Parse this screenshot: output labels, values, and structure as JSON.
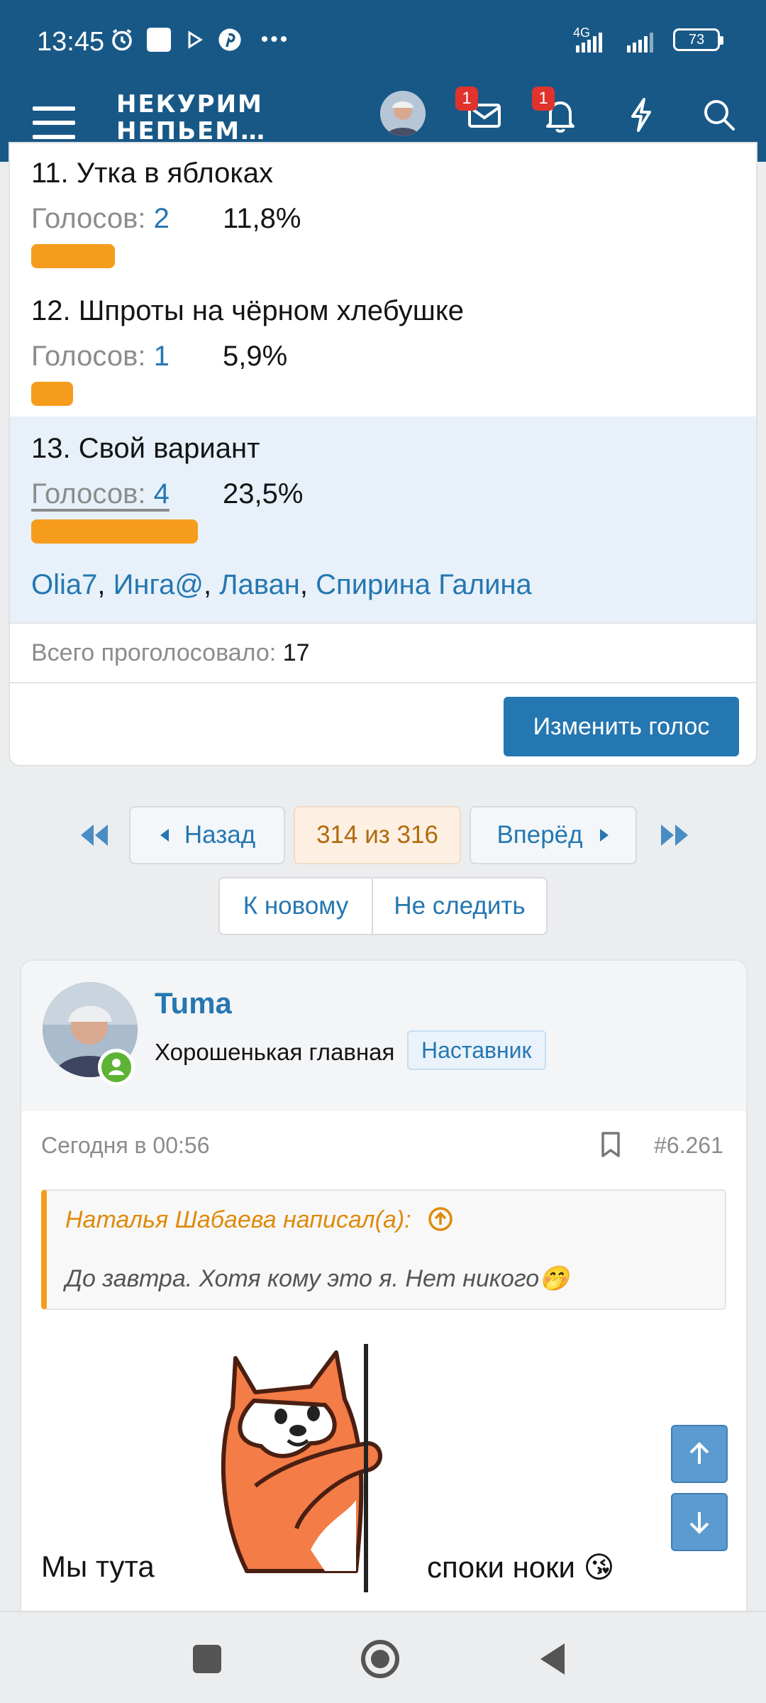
{
  "status_bar": {
    "time": "13:45",
    "network": "4G",
    "battery": "73",
    "icons": [
      "alarm-icon",
      "notification-square-icon",
      "play-icon",
      "pinterest-icon",
      "more-dots-icon",
      "signal-icon",
      "battery-icon"
    ]
  },
  "header": {
    "logo_line1": "НЕКУРИМ",
    "logo_line2": "НЕПЬЕМ…",
    "messages_badge": "1",
    "alerts_badge": "1",
    "accent_color": "#185886"
  },
  "poll": {
    "options": [
      {
        "title": "11. Утка в яблоках",
        "votes_label": "Голосов:",
        "votes": "2",
        "percent": "11,8%",
        "share": 0.118
      },
      {
        "title": "12. Шпроты на чёрном хлебушке",
        "votes_label": "Голосов:",
        "votes": "1",
        "percent": "5,9%",
        "share": 0.059
      },
      {
        "title": "13. Свой вариант",
        "votes_label": "Голосов:",
        "votes": "4",
        "percent": "23,5%",
        "share": 0.235
      }
    ],
    "voters": [
      "Olia7",
      "Инга@",
      "Лаван",
      "Спирина Галина"
    ],
    "total_label": "Всего проголосовало:",
    "total_value": "17",
    "change_vote": "Изменить голос",
    "bar_color": "#f59c1c"
  },
  "pagination": {
    "prev": "Назад",
    "current": "314 из 316",
    "next": "Вперёд",
    "to_new": "К новому",
    "unwatch": "Не следить"
  },
  "post": {
    "username": "Tuma",
    "user_title": "Хорошенькая главная",
    "role": "Наставник",
    "date": "Сегодня в 00:56",
    "number": "#6.261",
    "quote_author": "Наталья Шабаева написал(а):",
    "quote_text": "До завтра. Хотя кому это я. Нет никого🤭",
    "message_left": "Мы тута",
    "message_right": "споки ноки 😘"
  }
}
